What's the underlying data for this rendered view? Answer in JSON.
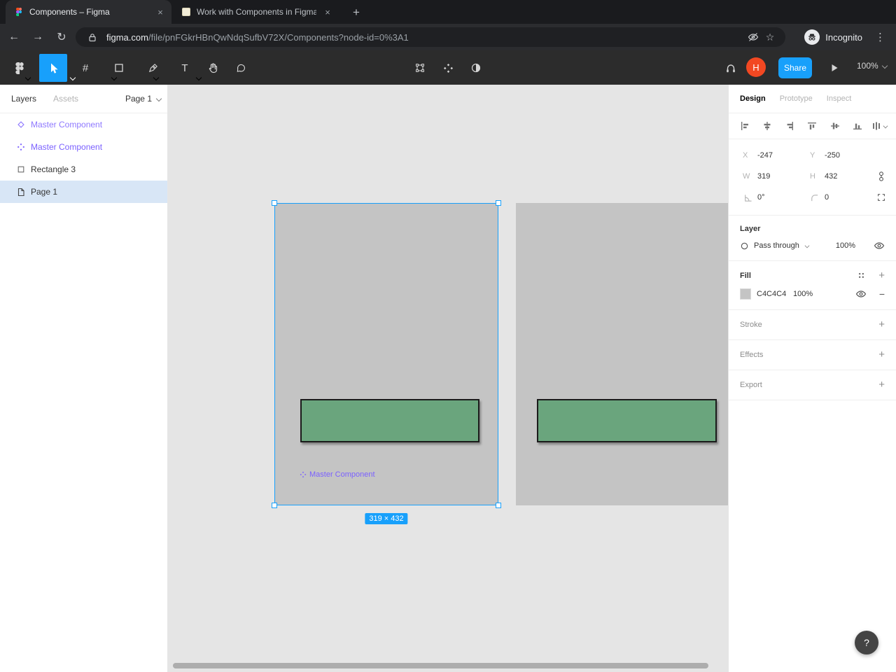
{
  "browser": {
    "tabs": [
      {
        "title": "Components – Figma"
      },
      {
        "title": "Work with Components in Figma"
      }
    ],
    "url": {
      "domain": "figma.com",
      "path": "/file/pnFGkrHBnQwNdqSufbV72X/Components?node-id=0%3A1"
    },
    "profile_label": "Incognito"
  },
  "glyphs": {
    "close": "×",
    "new_tab": "+",
    "back": "←",
    "forward": "→",
    "reload": "↻",
    "star": "☆",
    "menu": "⋮",
    "plus": "+",
    "minus": "−",
    "help": "?",
    "text_tool": "T",
    "frame_tool": "#"
  },
  "figma_toolbar": {
    "share_label": "Share",
    "zoom_label": "100%",
    "avatar_initial": "H"
  },
  "layers_panel": {
    "tab_layers": "Layers",
    "tab_assets": "Assets",
    "page_selector": "Page 1",
    "items": [
      {
        "name": "Master Component"
      },
      {
        "name": "Master Component"
      },
      {
        "name": "Rectangle 3"
      },
      {
        "name": "Page 1"
      }
    ]
  },
  "canvas": {
    "component_label": "Master Component",
    "selection_size": "319 × 432"
  },
  "inspector": {
    "tabs": [
      "Design",
      "Prototype",
      "Inspect"
    ],
    "x_label": "X",
    "x_value": "-247",
    "y_label": "Y",
    "y_value": "-250",
    "w_label": "W",
    "w_value": "319",
    "h_label": "H",
    "h_value": "432",
    "rotation_value": "0°",
    "radius_value": "0",
    "layer": {
      "title": "Layer",
      "blend_mode": "Pass through",
      "opacity": "100%"
    },
    "fill": {
      "title": "Fill",
      "hex": "C4C4C4",
      "opacity": "100%"
    },
    "stroke_title": "Stroke",
    "effects_title": "Effects",
    "export_title": "Export"
  },
  "colors": {
    "accent_blue": "#18A0FB",
    "component_purple": "#7B61FF",
    "fill_gray": "#C4C4C4",
    "object_green": "#6AA57D",
    "canvas_bg": "#E5E5E5"
  }
}
